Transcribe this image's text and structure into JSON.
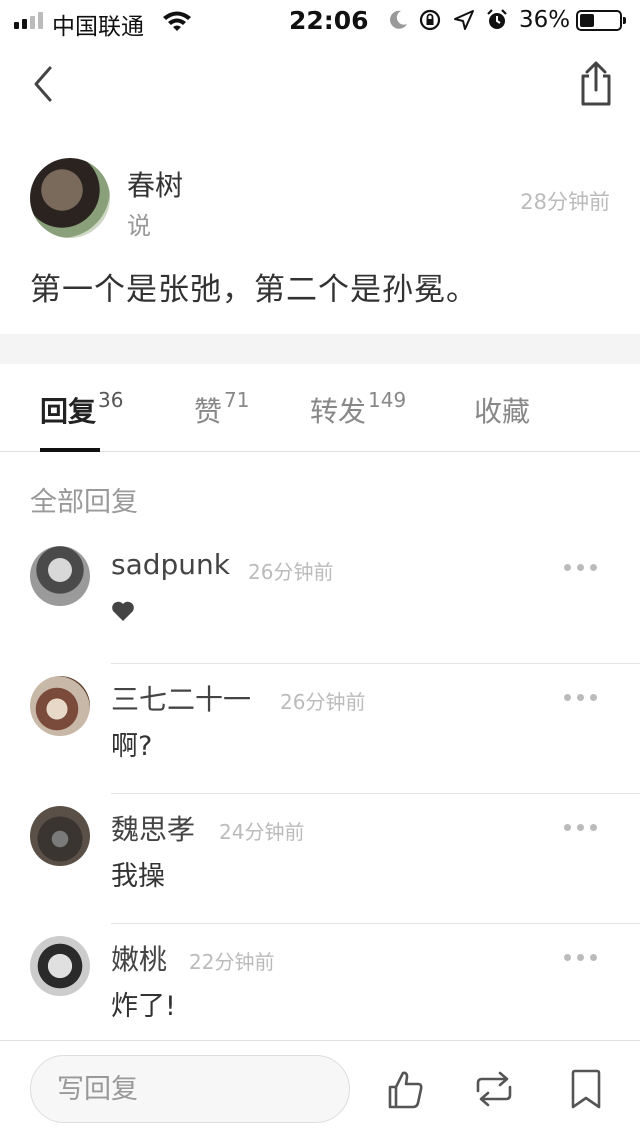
{
  "status_bar": {
    "carrier": "中国联通",
    "time": "22:06",
    "battery": "36%",
    "battery_level": 0.36,
    "icons": [
      "signal-icon",
      "wifi-icon",
      "moon-icon",
      "orientation-lock-icon",
      "location-icon",
      "alarm-icon",
      "battery-icon"
    ]
  },
  "nav": {
    "back_icon": "chevron-left-icon",
    "share_icon": "share-icon"
  },
  "post": {
    "author": "春树",
    "verb": "说",
    "time": "28分钟前",
    "content": "第一个是张弛，第二个是孙冕。"
  },
  "tabs": [
    {
      "label": "回复",
      "count": "36",
      "active": true
    },
    {
      "label": "赞",
      "count": "71",
      "active": false
    },
    {
      "label": "转发",
      "count": "149",
      "active": false
    },
    {
      "label": "收藏",
      "count": "",
      "active": false
    }
  ],
  "section_label": "全部回复",
  "replies": [
    {
      "name": "sadpunk",
      "time": "26分钟前",
      "text": "",
      "icon": "heart-icon"
    },
    {
      "name": "三七二十一",
      "time": "26分钟前",
      "text": "啊?"
    },
    {
      "name": "魏思孝",
      "time": "24分钟前",
      "text": "我操"
    },
    {
      "name": "嫩桃",
      "time": "22分钟前",
      "text": "炸了!"
    }
  ],
  "bottom_bar": {
    "input_placeholder": "写回复",
    "icons": [
      "thumbs-up-icon",
      "repost-icon",
      "bookmark-icon"
    ]
  }
}
